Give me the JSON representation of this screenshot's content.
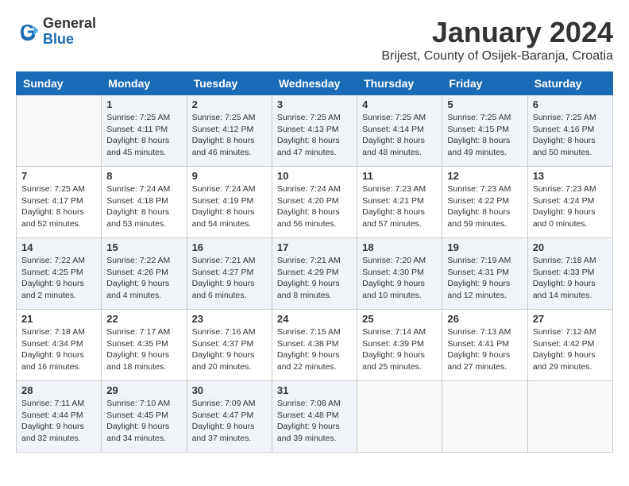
{
  "logo": {
    "general": "General",
    "blue": "Blue"
  },
  "title": "January 2024",
  "location": "Brijest, County of Osijek-Baranja, Croatia",
  "days_of_week": [
    "Sunday",
    "Monday",
    "Tuesday",
    "Wednesday",
    "Thursday",
    "Friday",
    "Saturday"
  ],
  "weeks": [
    [
      {
        "day": "",
        "sunrise": "",
        "sunset": "",
        "daylight": "",
        "empty": true
      },
      {
        "day": "1",
        "sunrise": "Sunrise: 7:25 AM",
        "sunset": "Sunset: 4:11 PM",
        "daylight": "Daylight: 8 hours and 45 minutes."
      },
      {
        "day": "2",
        "sunrise": "Sunrise: 7:25 AM",
        "sunset": "Sunset: 4:12 PM",
        "daylight": "Daylight: 8 hours and 46 minutes."
      },
      {
        "day": "3",
        "sunrise": "Sunrise: 7:25 AM",
        "sunset": "Sunset: 4:13 PM",
        "daylight": "Daylight: 8 hours and 47 minutes."
      },
      {
        "day": "4",
        "sunrise": "Sunrise: 7:25 AM",
        "sunset": "Sunset: 4:14 PM",
        "daylight": "Daylight: 8 hours and 48 minutes."
      },
      {
        "day": "5",
        "sunrise": "Sunrise: 7:25 AM",
        "sunset": "Sunset: 4:15 PM",
        "daylight": "Daylight: 8 hours and 49 minutes."
      },
      {
        "day": "6",
        "sunrise": "Sunrise: 7:25 AM",
        "sunset": "Sunset: 4:16 PM",
        "daylight": "Daylight: 8 hours and 50 minutes."
      }
    ],
    [
      {
        "day": "7",
        "sunrise": "Sunrise: 7:25 AM",
        "sunset": "Sunset: 4:17 PM",
        "daylight": "Daylight: 8 hours and 52 minutes."
      },
      {
        "day": "8",
        "sunrise": "Sunrise: 7:24 AM",
        "sunset": "Sunset: 4:18 PM",
        "daylight": "Daylight: 8 hours and 53 minutes."
      },
      {
        "day": "9",
        "sunrise": "Sunrise: 7:24 AM",
        "sunset": "Sunset: 4:19 PM",
        "daylight": "Daylight: 8 hours and 54 minutes."
      },
      {
        "day": "10",
        "sunrise": "Sunrise: 7:24 AM",
        "sunset": "Sunset: 4:20 PM",
        "daylight": "Daylight: 8 hours and 56 minutes."
      },
      {
        "day": "11",
        "sunrise": "Sunrise: 7:23 AM",
        "sunset": "Sunset: 4:21 PM",
        "daylight": "Daylight: 8 hours and 57 minutes."
      },
      {
        "day": "12",
        "sunrise": "Sunrise: 7:23 AM",
        "sunset": "Sunset: 4:22 PM",
        "daylight": "Daylight: 8 hours and 59 minutes."
      },
      {
        "day": "13",
        "sunrise": "Sunrise: 7:23 AM",
        "sunset": "Sunset: 4:24 PM",
        "daylight": "Daylight: 9 hours and 0 minutes."
      }
    ],
    [
      {
        "day": "14",
        "sunrise": "Sunrise: 7:22 AM",
        "sunset": "Sunset: 4:25 PM",
        "daylight": "Daylight: 9 hours and 2 minutes."
      },
      {
        "day": "15",
        "sunrise": "Sunrise: 7:22 AM",
        "sunset": "Sunset: 4:26 PM",
        "daylight": "Daylight: 9 hours and 4 minutes."
      },
      {
        "day": "16",
        "sunrise": "Sunrise: 7:21 AM",
        "sunset": "Sunset: 4:27 PM",
        "daylight": "Daylight: 9 hours and 6 minutes."
      },
      {
        "day": "17",
        "sunrise": "Sunrise: 7:21 AM",
        "sunset": "Sunset: 4:29 PM",
        "daylight": "Daylight: 9 hours and 8 minutes."
      },
      {
        "day": "18",
        "sunrise": "Sunrise: 7:20 AM",
        "sunset": "Sunset: 4:30 PM",
        "daylight": "Daylight: 9 hours and 10 minutes."
      },
      {
        "day": "19",
        "sunrise": "Sunrise: 7:19 AM",
        "sunset": "Sunset: 4:31 PM",
        "daylight": "Daylight: 9 hours and 12 minutes."
      },
      {
        "day": "20",
        "sunrise": "Sunrise: 7:18 AM",
        "sunset": "Sunset: 4:33 PM",
        "daylight": "Daylight: 9 hours and 14 minutes."
      }
    ],
    [
      {
        "day": "21",
        "sunrise": "Sunrise: 7:18 AM",
        "sunset": "Sunset: 4:34 PM",
        "daylight": "Daylight: 9 hours and 16 minutes."
      },
      {
        "day": "22",
        "sunrise": "Sunrise: 7:17 AM",
        "sunset": "Sunset: 4:35 PM",
        "daylight": "Daylight: 9 hours and 18 minutes."
      },
      {
        "day": "23",
        "sunrise": "Sunrise: 7:16 AM",
        "sunset": "Sunset: 4:37 PM",
        "daylight": "Daylight: 9 hours and 20 minutes."
      },
      {
        "day": "24",
        "sunrise": "Sunrise: 7:15 AM",
        "sunset": "Sunset: 4:38 PM",
        "daylight": "Daylight: 9 hours and 22 minutes."
      },
      {
        "day": "25",
        "sunrise": "Sunrise: 7:14 AM",
        "sunset": "Sunset: 4:39 PM",
        "daylight": "Daylight: 9 hours and 25 minutes."
      },
      {
        "day": "26",
        "sunrise": "Sunrise: 7:13 AM",
        "sunset": "Sunset: 4:41 PM",
        "daylight": "Daylight: 9 hours and 27 minutes."
      },
      {
        "day": "27",
        "sunrise": "Sunrise: 7:12 AM",
        "sunset": "Sunset: 4:42 PM",
        "daylight": "Daylight: 9 hours and 29 minutes."
      }
    ],
    [
      {
        "day": "28",
        "sunrise": "Sunrise: 7:11 AM",
        "sunset": "Sunset: 4:44 PM",
        "daylight": "Daylight: 9 hours and 32 minutes."
      },
      {
        "day": "29",
        "sunrise": "Sunrise: 7:10 AM",
        "sunset": "Sunset: 4:45 PM",
        "daylight": "Daylight: 9 hours and 34 minutes."
      },
      {
        "day": "30",
        "sunrise": "Sunrise: 7:09 AM",
        "sunset": "Sunset: 4:47 PM",
        "daylight": "Daylight: 9 hours and 37 minutes."
      },
      {
        "day": "31",
        "sunrise": "Sunrise: 7:08 AM",
        "sunset": "Sunset: 4:48 PM",
        "daylight": "Daylight: 9 hours and 39 minutes."
      },
      {
        "day": "",
        "sunrise": "",
        "sunset": "",
        "daylight": "",
        "empty": true
      },
      {
        "day": "",
        "sunrise": "",
        "sunset": "",
        "daylight": "",
        "empty": true
      },
      {
        "day": "",
        "sunrise": "",
        "sunset": "",
        "daylight": "",
        "empty": true
      }
    ]
  ]
}
